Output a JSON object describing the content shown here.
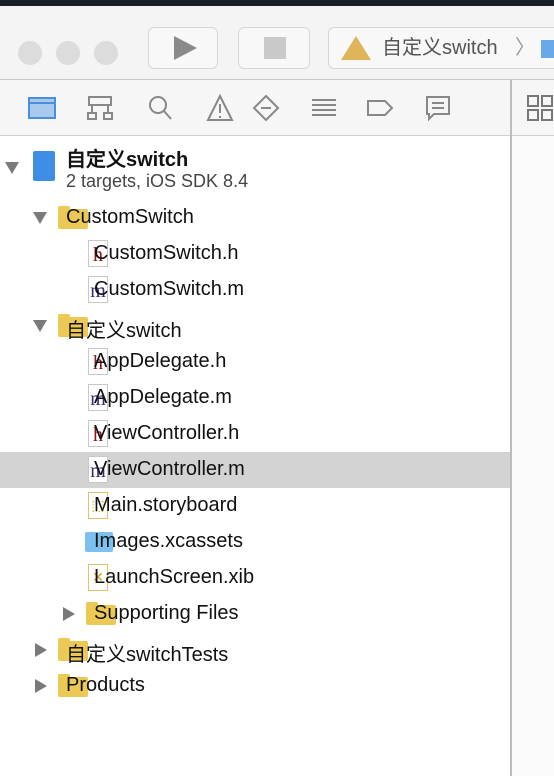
{
  "toolbar": {
    "scheme": "自定义switch",
    "run": "play-icon",
    "stop": "stop-icon"
  },
  "navigator_icons": [
    "folder-icon",
    "hierarchy-icon",
    "search-icon",
    "warning-icon",
    "test-diamond-icon",
    "list-icon",
    "breakpoint-tag-icon",
    "comment-icon"
  ],
  "colors": {
    "accent": "#4a90d9",
    "selection": "#d3d3d3",
    "folder": "#ecc955",
    "header_letter": "#8b1a1a",
    "impl_letter": "#3b2a7a"
  },
  "project": {
    "name": "自定义switch",
    "subtitle": "2 targets, iOS SDK 8.4"
  },
  "tree": [
    {
      "label": "CustomSwitch",
      "type": "folder",
      "expanded": true
    },
    {
      "label": "CustomSwitch.h",
      "type": "h"
    },
    {
      "label": "CustomSwitch.m",
      "type": "m"
    },
    {
      "label": "自定义switch",
      "type": "folder",
      "expanded": true
    },
    {
      "label": "AppDelegate.h",
      "type": "h"
    },
    {
      "label": "AppDelegate.m",
      "type": "m"
    },
    {
      "label": "ViewController.h",
      "type": "h"
    },
    {
      "label": "ViewController.m",
      "type": "m",
      "selected": true
    },
    {
      "label": "Main.storyboard",
      "type": "storyboard"
    },
    {
      "label": "Images.xcassets",
      "type": "xcassets"
    },
    {
      "label": "LaunchScreen.xib",
      "type": "xib"
    },
    {
      "label": "Supporting Files",
      "type": "folder",
      "expanded": false
    },
    {
      "label": "自定义switchTests",
      "type": "folder",
      "expanded": false
    },
    {
      "label": "Products",
      "type": "folder",
      "expanded": false
    }
  ],
  "file_letters": {
    "h": "h",
    "m": "m"
  }
}
